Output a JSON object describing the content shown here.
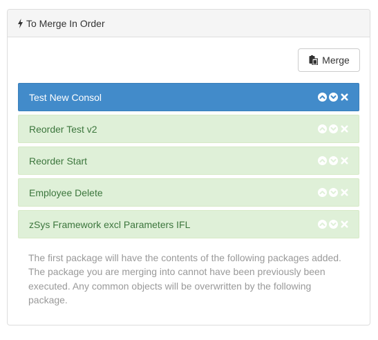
{
  "panel": {
    "title": "To Merge In Order",
    "title_icon": "bolt-icon"
  },
  "toolbar": {
    "merge_label": "Merge",
    "merge_icon": "paste-icon"
  },
  "packages": [
    {
      "label": "Test New Consol",
      "active": true
    },
    {
      "label": "Reorder Test v2",
      "active": false
    },
    {
      "label": "Reorder Start",
      "active": false
    },
    {
      "label": "Employee Delete",
      "active": false
    },
    {
      "label": "zSys Framework excl Parameters IFL",
      "active": false
    }
  ],
  "item_actions": [
    "move-up-icon",
    "move-down-icon",
    "remove-icon"
  ],
  "help_text": "The first package will have the contents of the following packages added. The package you are merging into cannot have been previously been executed. Any common objects will be overwritten by the following package.",
  "colors": {
    "active_bg": "#428bca",
    "item_bg": "#dff0d8",
    "item_text": "#3c763d",
    "help_text": "#999999"
  }
}
